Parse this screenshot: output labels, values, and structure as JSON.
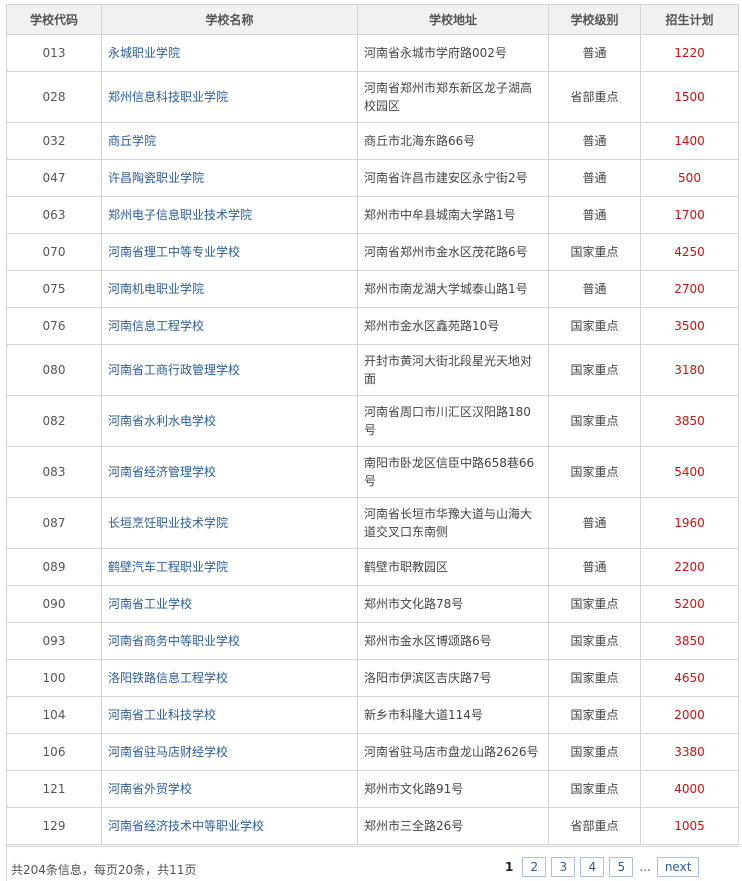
{
  "table": {
    "headers": {
      "code": "学校代码",
      "name": "学校名称",
      "address": "学校地址",
      "level": "学校级别",
      "plan": "招生计划"
    },
    "rows": [
      {
        "code": "013",
        "name": "永城职业学院",
        "address": "河南省永城市学府路002号",
        "level": "普通",
        "plan": "1220"
      },
      {
        "code": "028",
        "name": "郑州信息科技职业学院",
        "address": "河南省郑州市郑东新区龙子湖高校园区",
        "level": "省部重点",
        "plan": "1500"
      },
      {
        "code": "032",
        "name": "商丘学院",
        "address": "商丘市北海东路66号",
        "level": "普通",
        "plan": "1400"
      },
      {
        "code": "047",
        "name": "许昌陶瓷职业学院",
        "address": "河南省许昌市建安区永宁街2号",
        "level": "普通",
        "plan": "500"
      },
      {
        "code": "063",
        "name": "郑州电子信息职业技术学院",
        "address": "郑州市中牟县城南大学路1号",
        "level": "普通",
        "plan": "1700"
      },
      {
        "code": "070",
        "name": "河南省理工中等专业学校",
        "address": "河南省郑州市金水区茂花路6号",
        "level": "国家重点",
        "plan": "4250"
      },
      {
        "code": "075",
        "name": "河南机电职业学院",
        "address": "郑州市南龙湖大学城泰山路1号",
        "level": "普通",
        "plan": "2700"
      },
      {
        "code": "076",
        "name": "河南信息工程学校",
        "address": "郑州市金水区鑫苑路10号",
        "level": "国家重点",
        "plan": "3500"
      },
      {
        "code": "080",
        "name": "河南省工商行政管理学校",
        "address": "开封市黄河大街北段星光天地对面",
        "level": "国家重点",
        "plan": "3180"
      },
      {
        "code": "082",
        "name": "河南省水利水电学校",
        "address": "河南省周口市川汇区汉阳路180号",
        "level": "国家重点",
        "plan": "3850"
      },
      {
        "code": "083",
        "name": "河南省经济管理学校",
        "address": "南阳市卧龙区信臣中路658巷66号",
        "level": "国家重点",
        "plan": "5400"
      },
      {
        "code": "087",
        "name": "长垣烹饪职业技术学院",
        "address": "河南省长垣市华豫大道与山海大道交叉口东南侧",
        "level": "普通",
        "plan": "1960"
      },
      {
        "code": "089",
        "name": "鹤壁汽车工程职业学院",
        "address": "鹤壁市职教园区",
        "level": "普通",
        "plan": "2200"
      },
      {
        "code": "090",
        "name": "河南省工业学校",
        "address": "郑州市文化路78号",
        "level": "国家重点",
        "plan": "5200"
      },
      {
        "code": "093",
        "name": "河南省商务中等职业学校",
        "address": "郑州市金水区博颂路6号",
        "level": "国家重点",
        "plan": "3850"
      },
      {
        "code": "100",
        "name": "洛阳铁路信息工程学校",
        "address": "洛阳市伊滨区吉庆路7号",
        "level": "国家重点",
        "plan": "4650"
      },
      {
        "code": "104",
        "name": "河南省工业科技学校",
        "address": "新乡市科隆大道114号",
        "level": "国家重点",
        "plan": "2000"
      },
      {
        "code": "106",
        "name": "河南省驻马店财经学校",
        "address": "河南省驻马店市盘龙山路2626号",
        "level": "国家重点",
        "plan": "3380"
      },
      {
        "code": "121",
        "name": "河南省外贸学校",
        "address": "郑州市文化路91号",
        "level": "国家重点",
        "plan": "4000"
      },
      {
        "code": "129",
        "name": "河南省经济技术中等职业学校",
        "address": "郑州市三全路26号",
        "level": "省部重点",
        "plan": "1005"
      }
    ]
  },
  "footer": {
    "summary": "共204条信息，每页20条，共11页",
    "current_page": "1",
    "pages": [
      "2",
      "3",
      "4",
      "5"
    ],
    "ellipsis": "...",
    "next_label": "next"
  }
}
